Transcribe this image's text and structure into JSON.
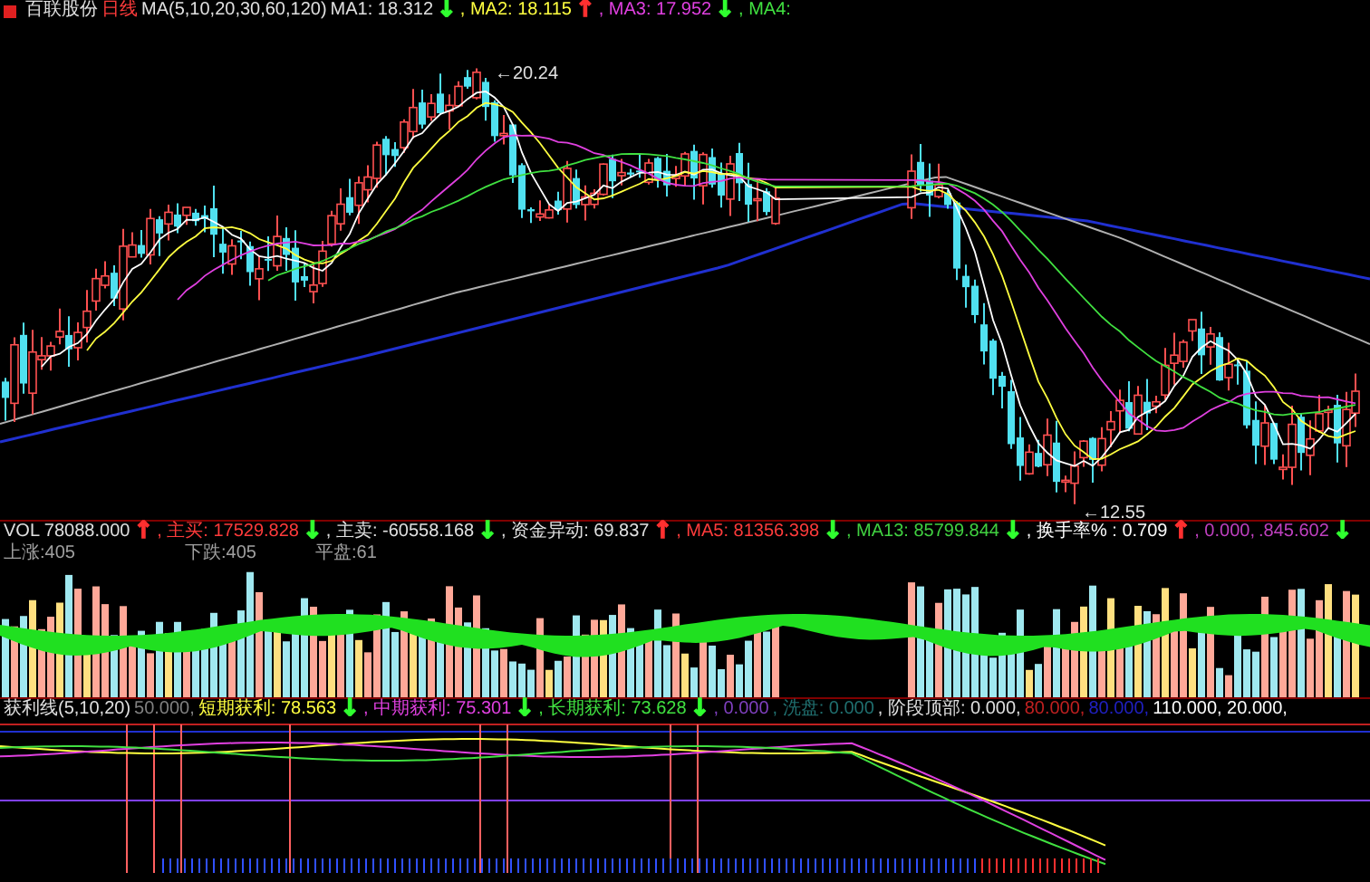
{
  "main": {
    "legend": [
      {
        "text": "百联股份",
        "color": "#e0e0e0"
      },
      {
        "text": "日线",
        "color": "#ff3b3b"
      },
      {
        "text": "MA(5,10,20,30,60,120)",
        "color": "#e0e0e0"
      },
      {
        "text": "MA1: 18.312",
        "color": "#e0e0e0"
      },
      {
        "text": "↓",
        "color": "#30ff30",
        "kind": "arrow"
      },
      {
        "text": ", MA2: 18.115",
        "color": "#ffff40"
      },
      {
        "text": "↑",
        "color": "#ff3030",
        "kind": "arrow"
      },
      {
        "text": ", MA3: 17.952",
        "color": "#e040e0"
      },
      {
        "text": "↓",
        "color": "#30ff30",
        "kind": "arrow"
      },
      {
        "text": ", MA4:",
        "color": "#40e040"
      }
    ],
    "annotations": [
      {
        "text": "←20.24",
        "kind": "high"
      },
      {
        "text": "←12.55",
        "kind": "low"
      }
    ]
  },
  "volume": {
    "legend": [
      {
        "text": "VOL 78088.000",
        "color": "#e0e0e0"
      },
      {
        "text": "↑",
        "color": "#ff3030",
        "kind": "arrow"
      },
      {
        "text": ", 主买: 17529.828",
        "color": "#ff3b3b"
      },
      {
        "text": "↓",
        "color": "#30ff30",
        "kind": "arrow"
      },
      {
        "text": ", 主卖: -60558.168",
        "color": "#e0e0e0"
      },
      {
        "text": "↓",
        "color": "#30ff30",
        "kind": "arrow"
      },
      {
        "text": ", 资金异动: 69.837",
        "color": "#e0e0e0"
      },
      {
        "text": "↑",
        "color": "#ff3030",
        "kind": "arrow"
      },
      {
        "text": ", MA5: 81356.398",
        "color": "#ff3b3b"
      },
      {
        "text": "↓",
        "color": "#30ff30",
        "kind": "arrow"
      },
      {
        "text": ", MA13: 85799.844",
        "color": "#40d040"
      },
      {
        "text": "↓",
        "color": "#30ff30",
        "kind": "arrow"
      },
      {
        "text": ", 换手率% : 0.709",
        "color": "#ffffff"
      },
      {
        "text": "↑",
        "color": "#ff3030",
        "kind": "arrow"
      },
      {
        "text": ", 0.000,",
        "color": "#c040c0"
      },
      {
        "text": ".845.602",
        "color": "#c040c0"
      },
      {
        "text": "↓",
        "color": "#30ff30",
        "kind": "arrow"
      }
    ],
    "stats": [
      "上涨:405",
      "下跌:405",
      "平盘:61"
    ]
  },
  "indicator": {
    "legend": [
      {
        "text": "获利线(5,10,20)",
        "color": "#e0e0e0"
      },
      {
        "text": "50.000,",
        "color": "#808080"
      },
      {
        "text": "短期获利: 78.563",
        "color": "#ffff40"
      },
      {
        "text": "↓",
        "color": "#30ff30",
        "kind": "arrow"
      },
      {
        "text": ", 中期获利: 75.301",
        "color": "#e040e0"
      },
      {
        "text": "↓",
        "color": "#30ff30",
        "kind": "arrow"
      },
      {
        "text": ", 长期获利: 73.628",
        "color": "#40e040"
      },
      {
        "text": "↓",
        "color": "#30ff30",
        "kind": "arrow"
      },
      {
        "text": ", 0.000",
        "color": "#8040c0"
      },
      {
        "text": ", 洗盘: 0.000",
        "color": "#207070"
      },
      {
        "text": ", 阶段顶部: 0.000,",
        "color": "#e0e0e0"
      },
      {
        "text": "80.000,",
        "color": "#c02020"
      },
      {
        "text": "80.000,",
        "color": "#2020c0"
      },
      {
        "text": "110.000, 20.000,",
        "color": "#ffffff"
      }
    ]
  }
}
